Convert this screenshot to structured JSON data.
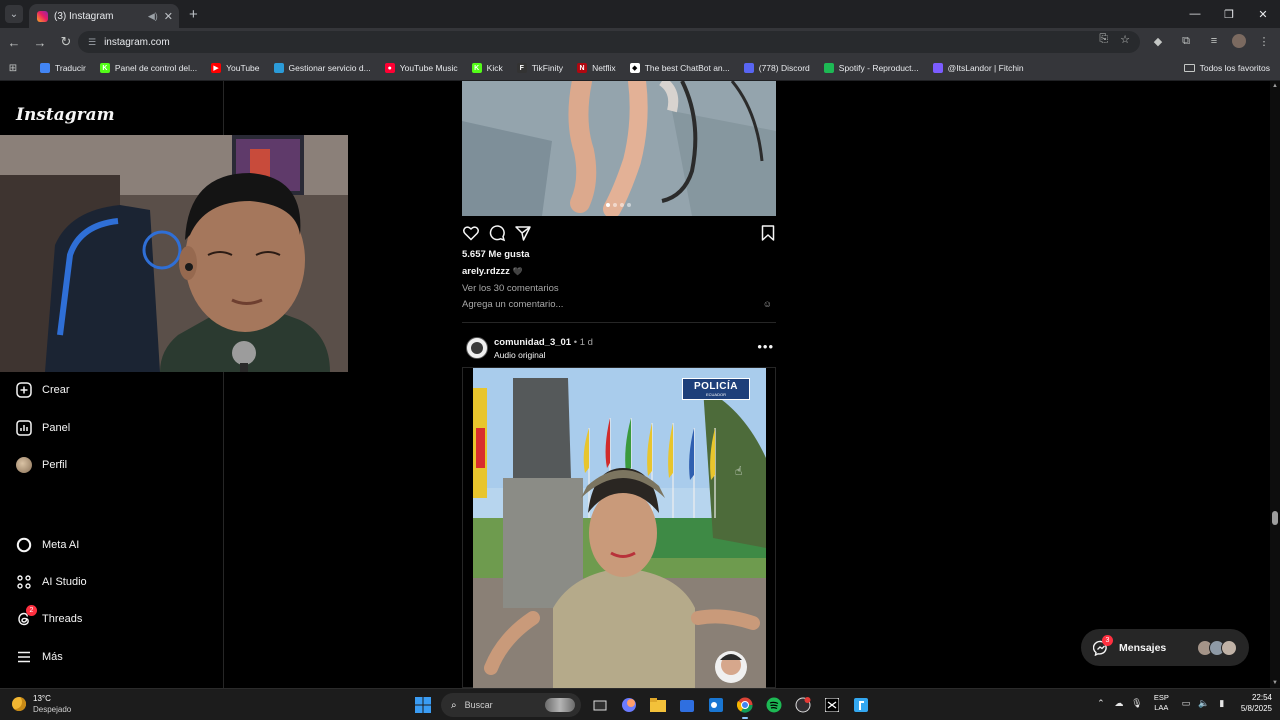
{
  "browser": {
    "tab": {
      "title": "(3) Instagram"
    },
    "address": "instagram.com",
    "bookmarks": [
      {
        "label": "Traducir",
        "color": "#4285f4",
        "glyph": ""
      },
      {
        "label": "Panel de control del...",
        "color": "#53fc18",
        "glyph": "K"
      },
      {
        "label": "YouTube",
        "color": "#ff0000",
        "glyph": "▶"
      },
      {
        "label": "Gestionar servicio d...",
        "color": "#2b9bd8",
        "glyph": ""
      },
      {
        "label": "YouTube Music",
        "color": "#ff0033",
        "glyph": "●"
      },
      {
        "label": "Kick",
        "color": "#53fc18",
        "glyph": "K"
      },
      {
        "label": "TikFinity",
        "color": "#333333",
        "glyph": "F"
      },
      {
        "label": "Netflix",
        "color": "#b00710",
        "glyph": "N"
      },
      {
        "label": "The best ChatBot an...",
        "color": "#ffffff",
        "glyph": "◆"
      },
      {
        "label": "(778) Discord",
        "color": "#5865f2",
        "glyph": ""
      },
      {
        "label": "Spotify - Reproduct...",
        "color": "#1db954",
        "glyph": ""
      },
      {
        "label": "@ItsLandor | Fitchin",
        "color": "#7b5cff",
        "glyph": ""
      }
    ],
    "bookmarks_all": "Todos los favoritos"
  },
  "sidebar": {
    "logo": "Instagram",
    "nav": {
      "create": "Crear",
      "panel": "Panel",
      "profile": "Perfil",
      "meta_ai": "Meta AI",
      "ai_studio": "AI Studio",
      "threads": "Threads",
      "threads_badge": "2",
      "more": "Más"
    }
  },
  "post1": {
    "likes": "5.657 Me gusta",
    "username": "arely.rdzzz",
    "caption_heart": "🖤",
    "view_comments": "Ver los 30 comentarios",
    "add_comment_placeholder": "Agrega un comentario...",
    "carousel_dots": 4,
    "carousel_active": 0
  },
  "post2": {
    "username": "comunidad_3_01",
    "separator": "•",
    "time": "1 d",
    "audio": "Audio original",
    "overlay_badge_title": "POLICÍA",
    "overlay_badge_sub": "ECUADOR"
  },
  "messages": {
    "label": "Mensajes",
    "badge": "3"
  },
  "taskbar": {
    "weather_temp": "13°C",
    "weather_desc": "Despejado",
    "search_placeholder": "Buscar",
    "lang_top": "ESP",
    "lang_bottom": "LAA",
    "time": "22:54",
    "date": "5/8/2025"
  },
  "colors": {
    "browser_bg": "#202124",
    "toolbar_bg": "#35363a",
    "ig_bg": "#000000",
    "ig_text": "#f5f5f5",
    "ig_secondary": "#a8a8a8",
    "badge_red": "#ff3040"
  }
}
